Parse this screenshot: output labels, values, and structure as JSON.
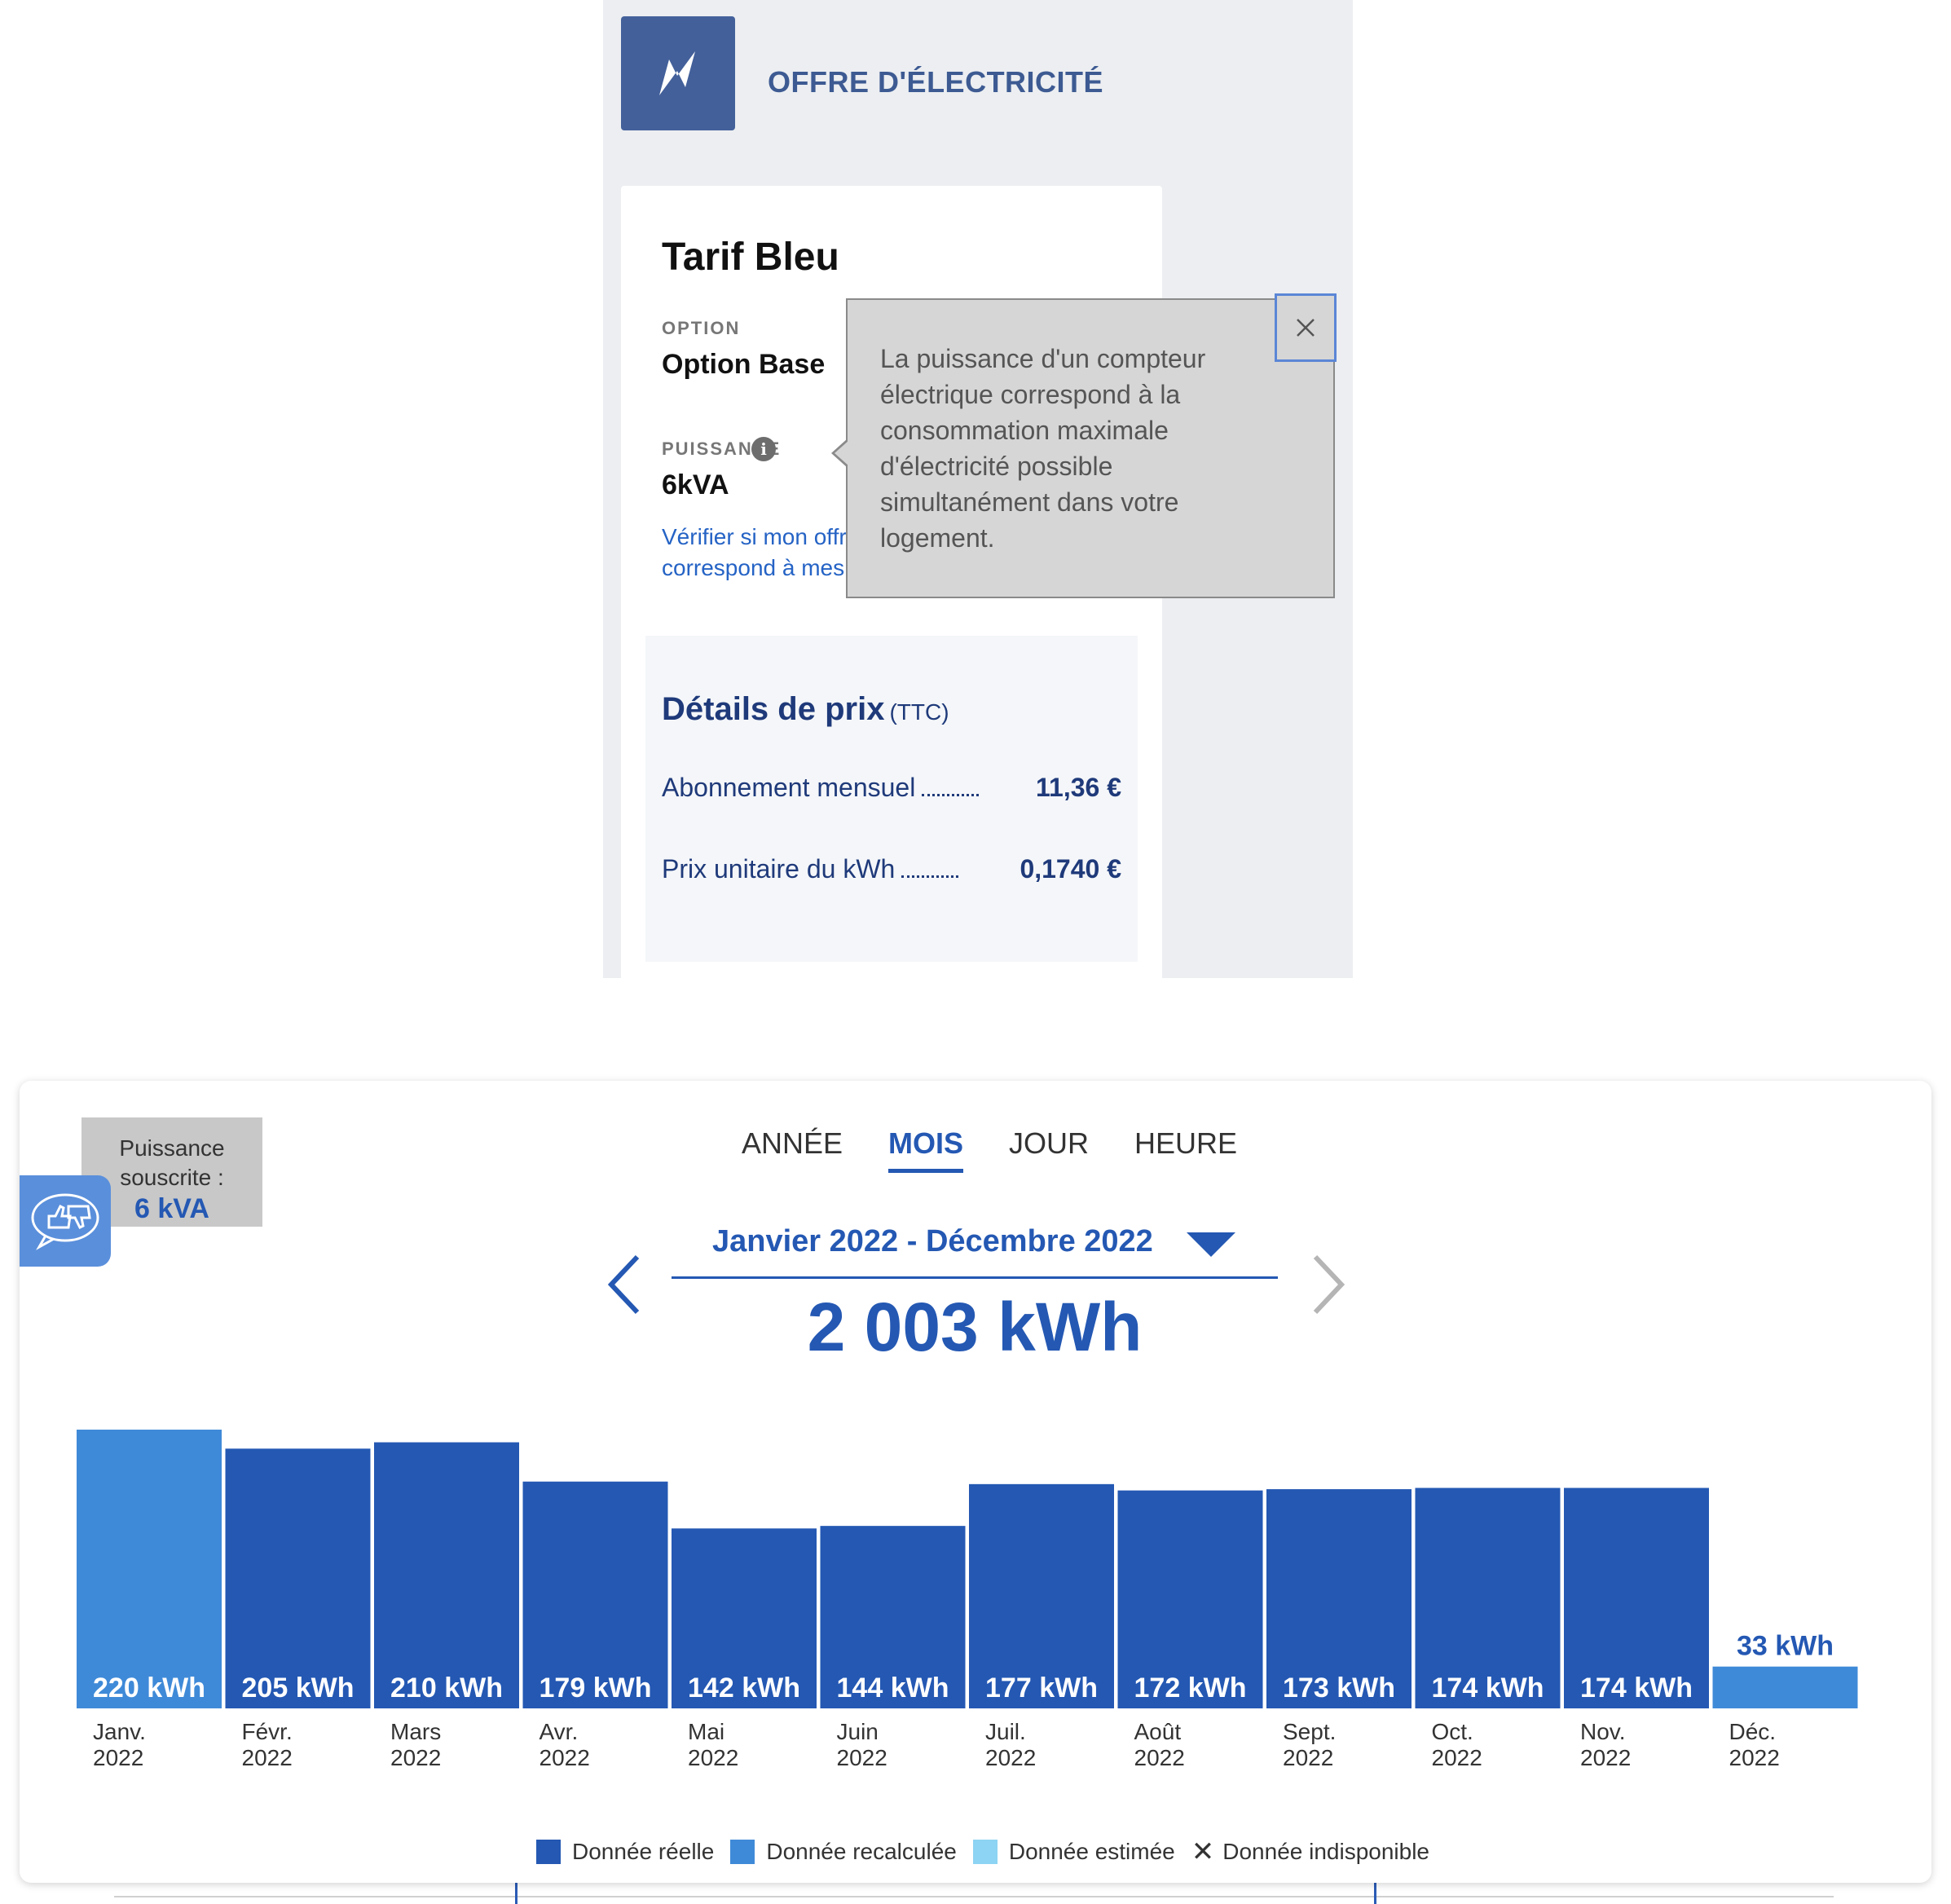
{
  "offer": {
    "title": "OFFRE D'ÉLECTRICITÉ",
    "icon": "lightning-icon",
    "tarif_name": "Tarif Bleu",
    "option_label": "OPTION",
    "option_value": "Option Base",
    "puissance_label": "PUISSANCE",
    "puissance_value": "6kVA",
    "verify_link": "Vérifier si mon offre correspond à mes usages",
    "price_details": {
      "title": "Détails de prix",
      "title_suffix": "(TTC)",
      "rows": [
        {
          "label": "Abonnement mensuel",
          "amount": "11,36 €"
        },
        {
          "label": "Prix unitaire du kWh",
          "amount": "0,1740 €"
        }
      ]
    }
  },
  "tooltip": {
    "text": "La puissance d'un compteur électrique correspond à la consommation maximale d'électricité possible simultanément dans votre logement.",
    "close_icon": "close-icon"
  },
  "consumption": {
    "badge_line1": "Puissance souscrite :",
    "badge_value": "6 kVA",
    "feedback_icon": "feedback-icon",
    "tabs": [
      {
        "label": "ANNÉE",
        "active": false
      },
      {
        "label": "MOIS",
        "active": true
      },
      {
        "label": "JOUR",
        "active": false
      },
      {
        "label": "HEURE",
        "active": false
      }
    ],
    "period": "Janvier 2022 - Décembre 2022",
    "total": "2 003 kWh",
    "legend": [
      {
        "label": "Donnée réelle",
        "color": "#2458b3"
      },
      {
        "label": "Donnée recalculée",
        "color": "#3f8ad8"
      },
      {
        "label": "Donnée estimée",
        "color": "#8dd3f3"
      },
      {
        "label": "Donnée indisponible",
        "color": "none"
      }
    ]
  },
  "chart_data": {
    "type": "bar",
    "categories": [
      "Janv. 2022",
      "Févr. 2022",
      "Mars 2022",
      "Avr. 2022",
      "Mai 2022",
      "Juin 2022",
      "Juil. 2022",
      "Août 2022",
      "Sept. 2022",
      "Oct. 2022",
      "Nov. 2022",
      "Déc. 2022"
    ],
    "category_lines": [
      [
        "Janv.",
        "2022"
      ],
      [
        "Févr.",
        "2022"
      ],
      [
        "Mars",
        "2022"
      ],
      [
        "Avr.",
        "2022"
      ],
      [
        "Mai",
        "2022"
      ],
      [
        "Juin",
        "2022"
      ],
      [
        "Juil.",
        "2022"
      ],
      [
        "Août",
        "2022"
      ],
      [
        "Sept.",
        "2022"
      ],
      [
        "Oct.",
        "2022"
      ],
      [
        "Nov.",
        "2022"
      ],
      [
        "Déc.",
        "2022"
      ]
    ],
    "values": [
      220,
      205,
      210,
      179,
      142,
      144,
      177,
      172,
      173,
      174,
      174,
      33
    ],
    "value_labels": [
      "220 kWh",
      "205 kWh",
      "210 kWh",
      "179 kWh",
      "142 kWh",
      "144 kWh",
      "177 kWh",
      "172 kWh",
      "173 kWh",
      "174 kWh",
      "174 kWh",
      "33 kWh"
    ],
    "data_type": [
      "recalculée",
      "réelle",
      "réelle",
      "réelle",
      "réelle",
      "réelle",
      "réelle",
      "réelle",
      "réelle",
      "réelle",
      "réelle",
      "recalculée"
    ],
    "colors": {
      "réelle": "#2458b3",
      "recalculée": "#3f8ad8"
    },
    "unit": "kWh",
    "title": "",
    "xlabel": "",
    "ylabel": "",
    "grid": false,
    "legend_position": "bottom"
  }
}
